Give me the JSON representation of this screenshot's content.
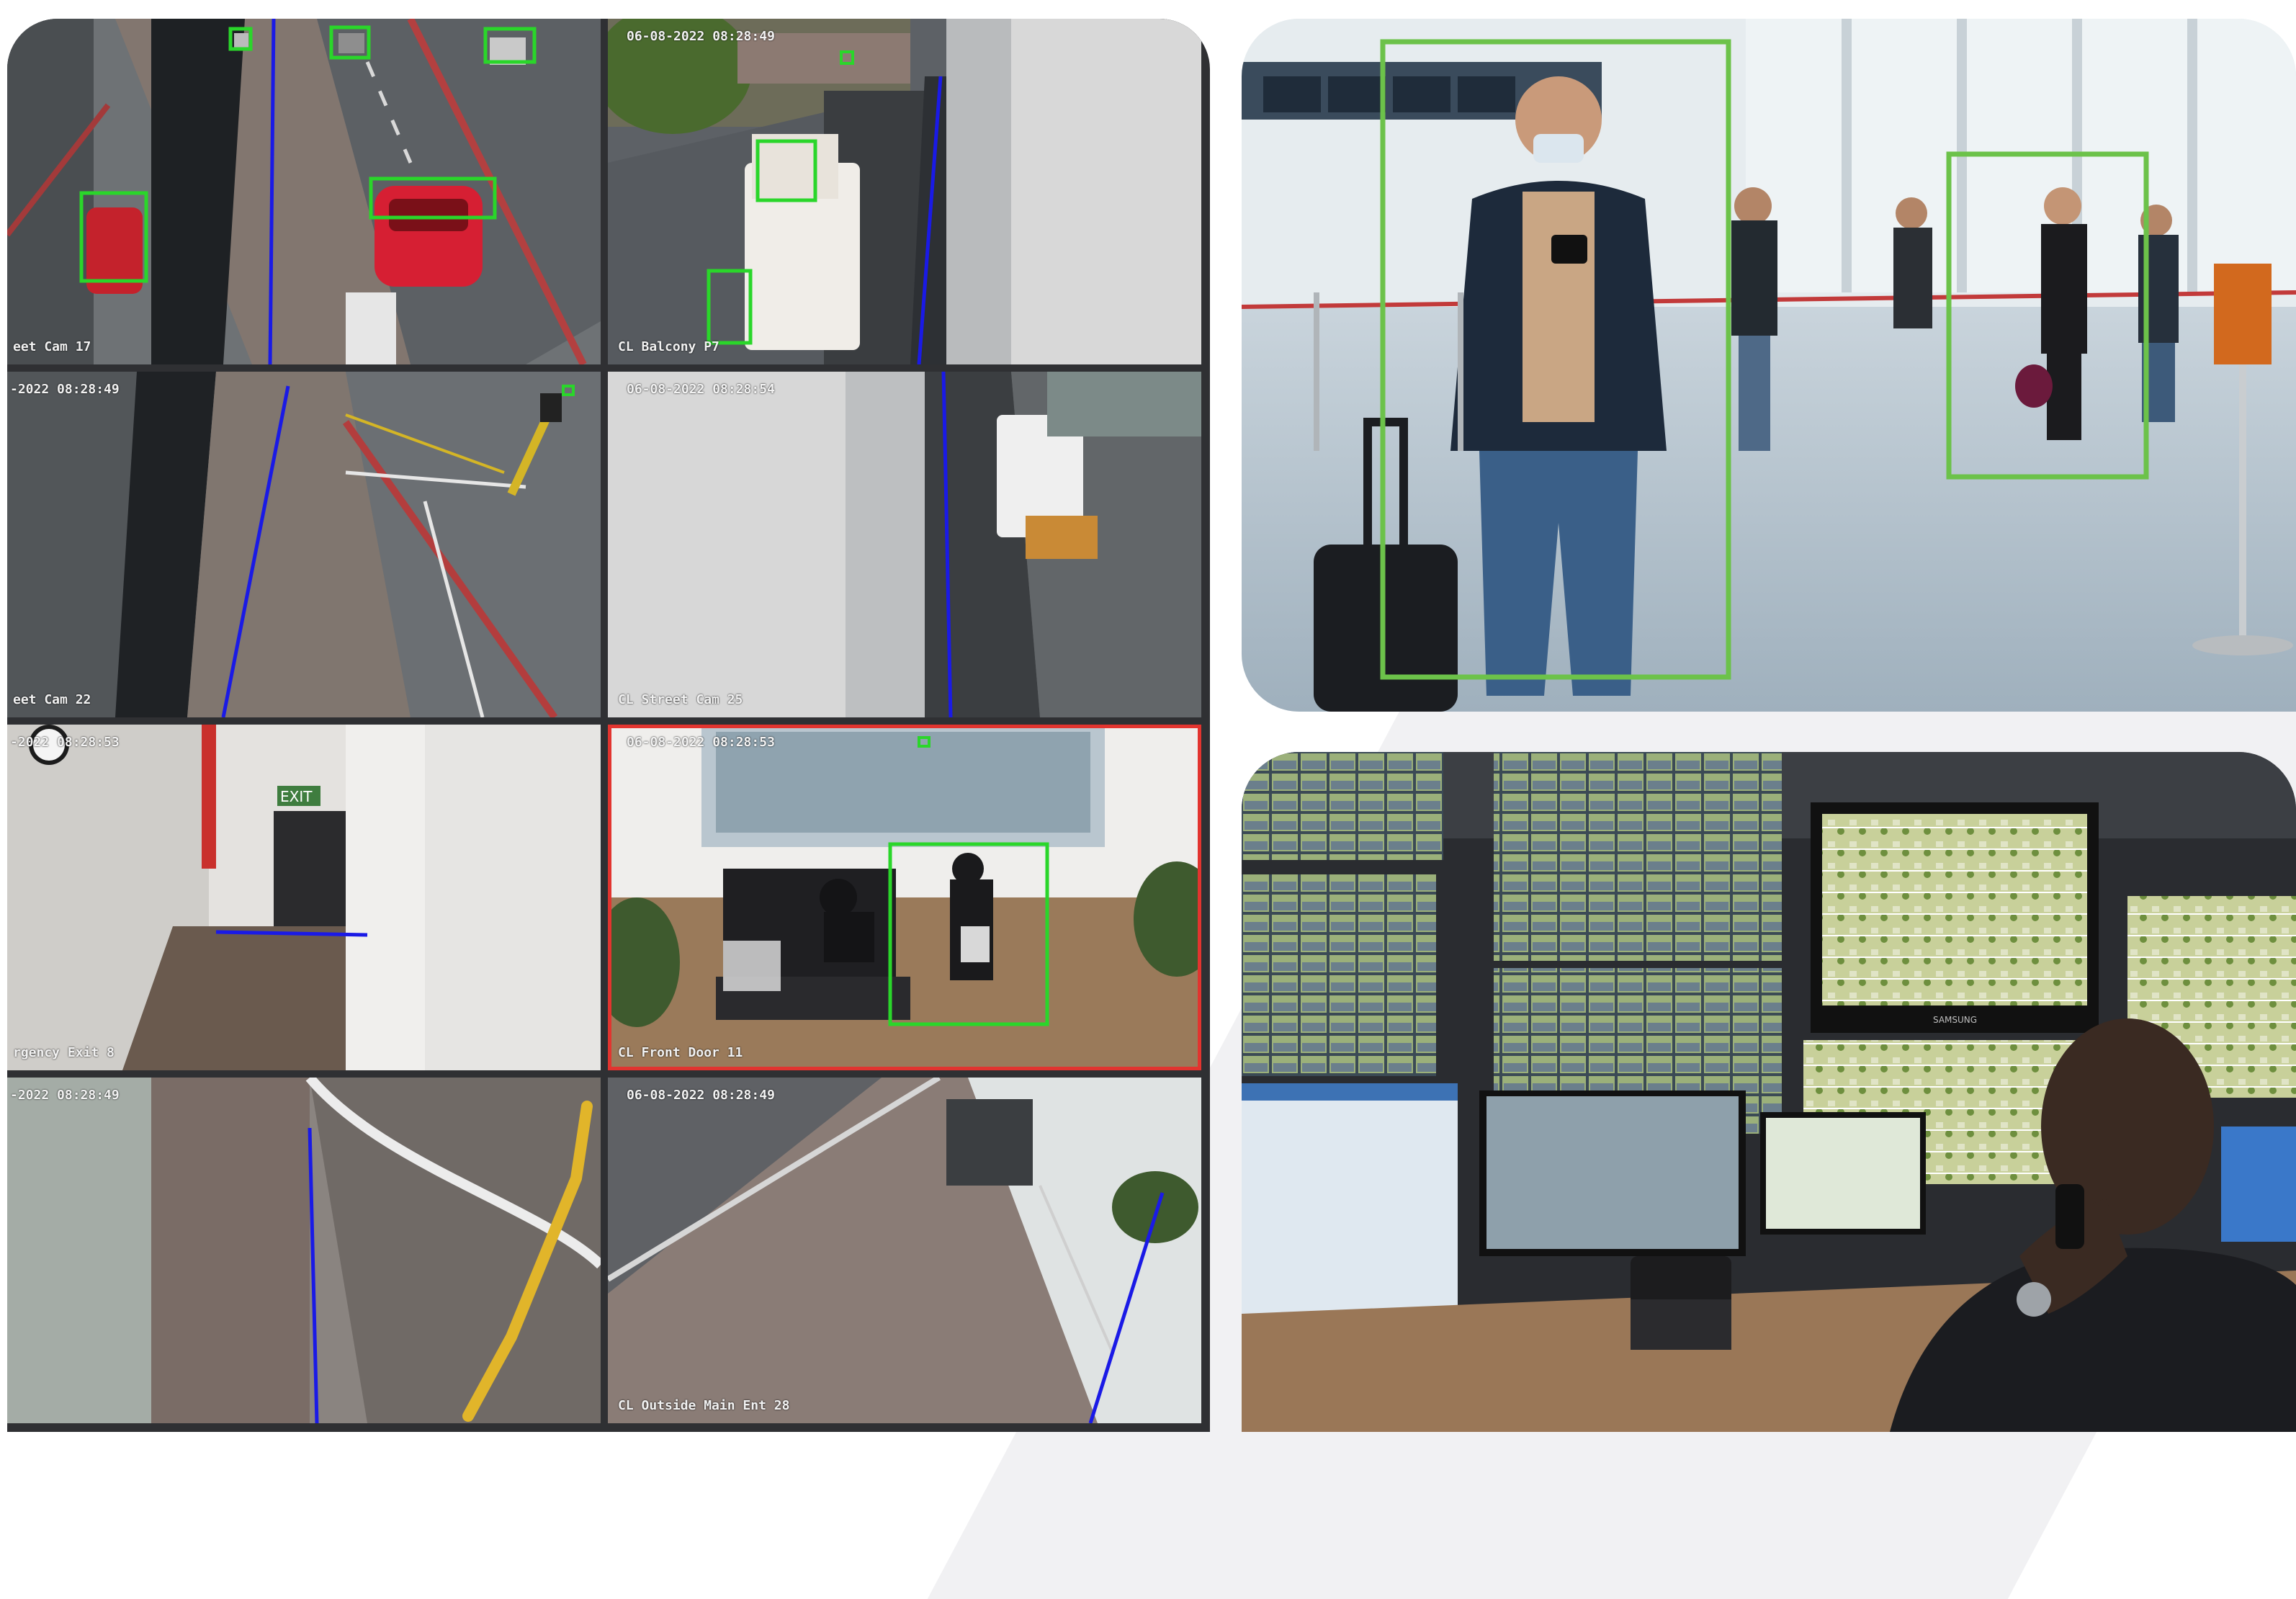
{
  "cctv": {
    "cameras": [
      {
        "timestamp": "",
        "label": "eet Cam 17"
      },
      {
        "timestamp": "06-08-2022 08:28:49",
        "label": "CL Balcony P7"
      },
      {
        "timestamp": "-2022 08:28:49",
        "label": "eet Cam 22"
      },
      {
        "timestamp": "06-08-2022 08:28:54",
        "label": "CL Street Cam 25"
      },
      {
        "timestamp": "-2022 08:28:53",
        "label": "rgency Exit 8"
      },
      {
        "timestamp": "06-08-2022 08:28:53",
        "label": "CL Front Door 11"
      },
      {
        "timestamp": "-2022 08:28:49",
        "label": ""
      },
      {
        "timestamp": "06-08-2022 08:28:49",
        "label": "CL Outside Main Ent 28"
      }
    ],
    "exit_sign": "EXIT",
    "alert_color": "#e2342f",
    "detection_color": "#2ad62a",
    "tripwire_color": "#1a1ae6"
  },
  "photos": {
    "airport_detection_color": "#6cc24a",
    "monitor_brand": "SAMSUNG"
  }
}
